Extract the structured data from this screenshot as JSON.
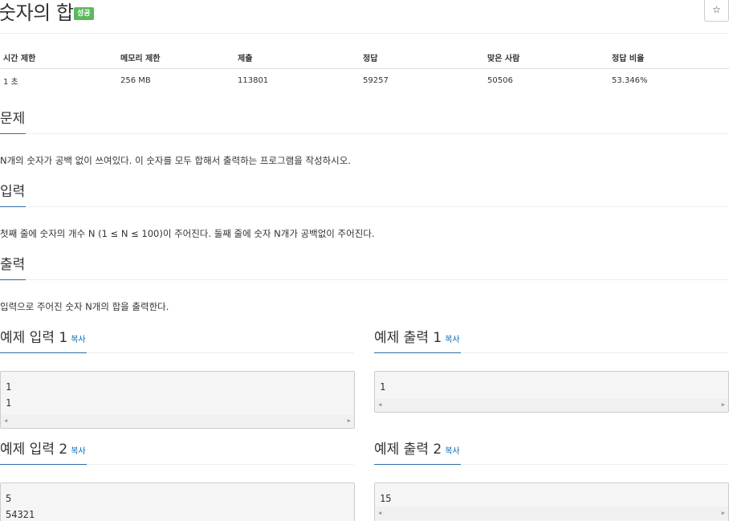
{
  "problem": {
    "title": "숫자의 합",
    "badge": "성공",
    "star_icon": "☆"
  },
  "stats": {
    "headers": [
      "시간 제한",
      "메모리 제한",
      "제출",
      "정답",
      "맞은 사람",
      "정답 비율"
    ],
    "values": [
      "1 초",
      "256 MB",
      "113801",
      "59257",
      "50506",
      "53.346%"
    ]
  },
  "sections": {
    "description": {
      "title": "문제",
      "text": "N개의 숫자가 공백 없이 쓰여있다. 이 숫자를 모두 합해서 출력하는 프로그램을 작성하시오."
    },
    "input": {
      "title": "입력",
      "text": "첫째 줄에 숫자의 개수 N (1 ≤ N ≤ 100)이 주어진다. 둘째 줄에 숫자 N개가 공백없이 주어진다."
    },
    "output": {
      "title": "출력",
      "text": "입력으로 주어진 숫자 N개의 합을 출력한다."
    }
  },
  "samples": {
    "copy_label": "복사",
    "in1": {
      "title": "예제 입력 1",
      "text": "1\n1"
    },
    "out1": {
      "title": "예제 출력 1",
      "text": "1"
    },
    "in2": {
      "title": "예제 입력 2",
      "text": "5\n54321"
    },
    "out2": {
      "title": "예제 출력 2",
      "text": "15"
    }
  },
  "scroll": {
    "left_arrow": "◀",
    "right_arrow": "▶"
  },
  "colors": {
    "accent": "#2c6ea8",
    "link": "#0d6aad",
    "success_badge": "#5cb85c"
  }
}
